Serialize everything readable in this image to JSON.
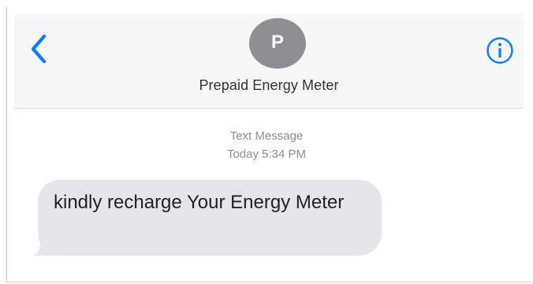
{
  "header": {
    "back_icon": "chevron-left-icon",
    "avatar_initial": "P",
    "contact_name": "Prepaid Energy Meter",
    "info_icon": "info-circle-icon"
  },
  "message_meta": {
    "type": "Text Message",
    "timestamp": "Today 5:34 PM"
  },
  "messages": [
    {
      "direction": "incoming",
      "text": "kindly recharge Your Energy Meter"
    }
  ],
  "colors": {
    "accent": "#0a7aff",
    "bubble_incoming": "#e5e5ea",
    "avatar": "#8e8e93",
    "meta_text": "#8e8e93"
  }
}
